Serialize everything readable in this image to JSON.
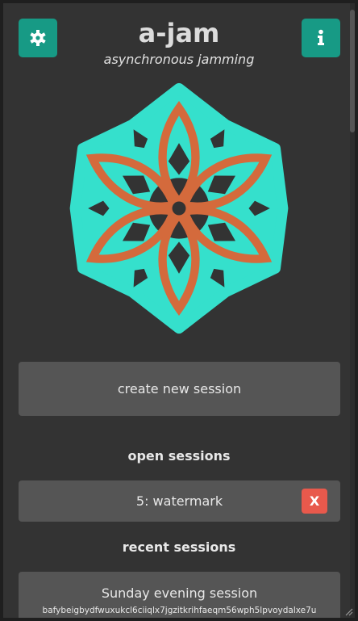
{
  "header": {
    "title": "a-jam",
    "subtitle": "asynchronous jamming",
    "settings_icon": "gear-icon",
    "info_icon": "info-icon"
  },
  "colors": {
    "accent": "#179a85",
    "logo_outer": "#35e0cc",
    "logo_inner": "#d46a3c",
    "danger": "#e8594c",
    "button_bg": "#555555",
    "background": "#333333"
  },
  "create_button": {
    "label": "create new session"
  },
  "open_sessions": {
    "heading": "open sessions",
    "items": [
      {
        "label": "5: watermark",
        "close_label": "X"
      }
    ]
  },
  "recent_sessions": {
    "heading": "recent sessions",
    "items": [
      {
        "name": "Sunday evening session",
        "cid": "bafybeigbydfwuxukcl6ciiqlx7jgzitkrihfaeqm56wph5lpvoydalxe7u"
      }
    ]
  }
}
